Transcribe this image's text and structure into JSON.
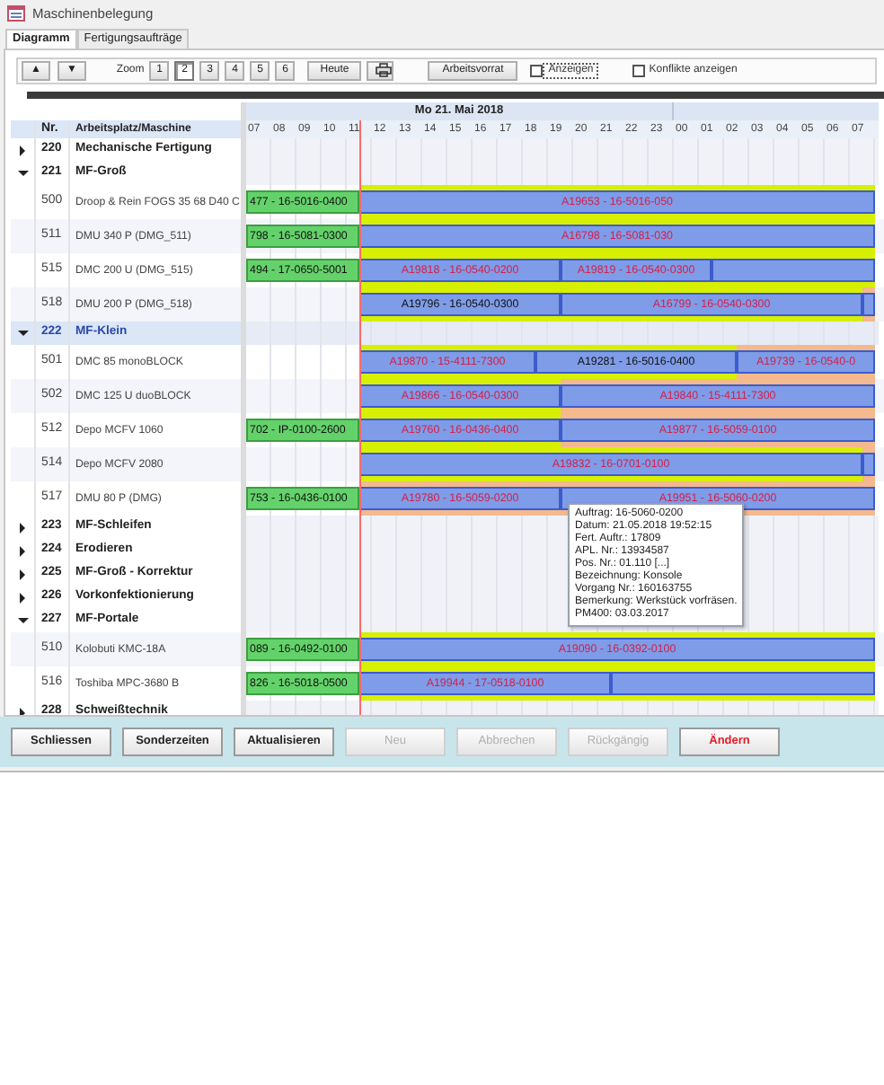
{
  "window": {
    "title": "Maschinenbelegung"
  },
  "tabs": [
    {
      "label": "Diagramm",
      "selected": true
    },
    {
      "label": "Fertigungsaufträge",
      "selected": false
    }
  ],
  "toolbar": {
    "up_button": "▲",
    "down_button": "▼",
    "zoom_label": "Zoom",
    "zoom_levels": [
      {
        "label": "1",
        "selected": false
      },
      {
        "label": "2",
        "selected": true
      },
      {
        "label": "3",
        "selected": false
      },
      {
        "label": "4",
        "selected": false
      },
      {
        "label": "5",
        "selected": false
      },
      {
        "label": "6",
        "selected": false
      }
    ],
    "today_button": "Heute",
    "backlog_button": "Arbeitsvorrat",
    "options": [
      {
        "label": "Anzeigen",
        "checked": false
      },
      {
        "label": "Konflikte anzeigen",
        "checked": false
      }
    ]
  },
  "timeline": {
    "days": [
      {
        "label": "Mo 21. Mai 2018"
      }
    ],
    "hours": [
      "07",
      "08",
      "09",
      "10",
      "11",
      "12",
      "13",
      "14",
      "15",
      "16",
      "17",
      "18",
      "19",
      "20",
      "21",
      "22",
      "23",
      "00",
      "01",
      "02",
      "03",
      "04",
      "05",
      "06",
      "07"
    ]
  },
  "columns": [
    "Nr.",
    "Arbeitsplatz/Maschine"
  ],
  "rows": [
    {
      "kind": "group",
      "nr": "220",
      "name": "Mechanische Fertigung",
      "expanded": false,
      "selected": false
    },
    {
      "kind": "group",
      "nr": "221",
      "name": "MF-Groß",
      "expanded": true,
      "selected": false
    },
    {
      "kind": "machine",
      "nr": "500",
      "name": "Droop & Rein FOGS 35 68 D40 C",
      "bars": [
        {
          "kind": "done",
          "label": "477 - 16-5016-0400",
          "overdue": false,
          "conflict": false
        },
        {
          "kind": "planned",
          "label": "A19653 - 16-5016-050",
          "overdue": true,
          "conflict": false
        }
      ]
    },
    {
      "kind": "machine",
      "nr": "511",
      "name": "DMU 340 P (DMG_511)",
      "bars": [
        {
          "kind": "done",
          "label": "798 - 16-5081-0300",
          "overdue": false,
          "conflict": false
        },
        {
          "kind": "planned",
          "label": "A16798 - 16-5081-030",
          "overdue": true,
          "conflict": false
        }
      ]
    },
    {
      "kind": "machine",
      "nr": "515",
      "name": "DMC 200 U (DMG_515)",
      "bars": [
        {
          "kind": "done",
          "label": "494 - 17-0650-5001",
          "overdue": false,
          "conflict": false
        },
        {
          "kind": "planned",
          "label": "A19818 - 16-0540-0200",
          "overdue": true,
          "conflict": false
        },
        {
          "kind": "planned",
          "label": "A19819 - 16-0540-0300",
          "overdue": true,
          "conflict": false
        },
        {
          "kind": "planned",
          "conflict": false
        }
      ]
    },
    {
      "kind": "machine",
      "nr": "518",
      "name": "DMU 200 P (DMG_518)",
      "bars": [
        {
          "kind": "planned",
          "label": "A19796 - 16-0540-0300",
          "overdue": false,
          "conflict": false
        },
        {
          "kind": "planned",
          "label": "A16799 - 16-0540-0300",
          "overdue": true,
          "conflict": false
        },
        {
          "kind": "planned",
          "conflict": true
        }
      ]
    },
    {
      "kind": "group",
      "nr": "222",
      "name": "MF-Klein",
      "expanded": true,
      "selected": true
    },
    {
      "kind": "machine",
      "nr": "501",
      "name": "DMC 85 monoBLOCK",
      "bars": [
        {
          "kind": "planned",
          "label": "A19870 - 15-4111-7300",
          "overdue": true,
          "conflict": false
        },
        {
          "kind": "planned",
          "label": "A19281 - 16-5016-0400",
          "overdue": false,
          "conflict": false
        },
        {
          "kind": "planned",
          "label": "A19739 - 16-0540-0",
          "overdue": true,
          "conflict": true
        }
      ]
    },
    {
      "kind": "machine",
      "nr": "502",
      "name": "DMC 125 U duoBLOCK",
      "bars": [
        {
          "kind": "planned",
          "label": "A19866 - 16-0540-0300",
          "overdue": true,
          "conflict": false
        },
        {
          "kind": "planned",
          "label": "A19840 - 15-4111-7300",
          "overdue": true,
          "conflict": true
        }
      ]
    },
    {
      "kind": "machine",
      "nr": "512",
      "name": "Depo MCFV 1060",
      "bars": [
        {
          "kind": "done",
          "label": "702 - IP-0100-2600",
          "overdue": false,
          "conflict": false
        },
        {
          "kind": "planned",
          "label": "A19760 - 16-0436-0400",
          "overdue": true,
          "conflict": false
        },
        {
          "kind": "planned",
          "label": "A19877 - 16-5059-0100",
          "overdue": true,
          "conflict": true
        }
      ]
    },
    {
      "kind": "machine",
      "nr": "514",
      "name": "Depo MCFV 2080",
      "bars": [
        {
          "kind": "planned",
          "label": "A19832 - 16-0701-0100",
          "overdue": true,
          "conflict": false
        },
        {
          "kind": "planned",
          "conflict": true
        }
      ]
    },
    {
      "kind": "machine",
      "nr": "517",
      "name": "DMU 80 P (DMG)",
      "bars": [
        {
          "kind": "done",
          "label": "753 - 16-0436-0100",
          "overdue": false,
          "conflict": false
        },
        {
          "kind": "planned",
          "label": "A19780 - 16-5059-0200",
          "overdue": true,
          "conflict": true
        },
        {
          "kind": "planned",
          "label": "A19951 - 16-5060-0200",
          "overdue": true,
          "conflict": true
        }
      ]
    },
    {
      "kind": "group",
      "nr": "223",
      "name": "MF-Schleifen",
      "expanded": false,
      "selected": false
    },
    {
      "kind": "group",
      "nr": "224",
      "name": "Erodieren",
      "expanded": false,
      "selected": false
    },
    {
      "kind": "group",
      "nr": "225",
      "name": "MF-Groß - Korrektur",
      "expanded": false,
      "selected": false
    },
    {
      "kind": "group",
      "nr": "226",
      "name": "Vorkonfektionierung",
      "expanded": false,
      "selected": false
    },
    {
      "kind": "group",
      "nr": "227",
      "name": "MF-Portale",
      "expanded": true,
      "selected": false
    },
    {
      "kind": "machine",
      "nr": "510",
      "name": "Kolobuti KMC-18A",
      "bars": [
        {
          "kind": "done",
          "label": "089 - 16-0492-0100",
          "overdue": false,
          "conflict": false
        },
        {
          "kind": "planned",
          "label": "A19090 - 16-0392-0100",
          "overdue": true,
          "conflict": false
        }
      ]
    },
    {
      "kind": "machine",
      "nr": "516",
      "name": "Toshiba MPC-3680 B",
      "bars": [
        {
          "kind": "done",
          "label": "826 - 16-5018-0500",
          "overdue": false,
          "conflict": false
        },
        {
          "kind": "planned",
          "label": "A19944 - 17-0518-0100",
          "overdue": true,
          "conflict": false
        },
        {
          "kind": "planned",
          "conflict": false
        }
      ]
    },
    {
      "kind": "group",
      "nr": "228",
      "name": "Schweißtechnik",
      "expanded": false,
      "selected": false
    }
  ],
  "tooltip": {
    "lines": [
      "Auftrag: 16-5060-0200",
      "Datum: 21.05.2018 19:52:15",
      "Fert. Auftr.: 17809",
      "APL. Nr.: 13934587",
      "Pos. Nr.: 01.110 [...]",
      "Bezeichnung: Konsole",
      "Vorgang Nr.: 160163755",
      "Bemerkung: Werkstück vorfräsen.",
      "PM400: 03.03.2017"
    ]
  },
  "buttons": [
    {
      "label": "Schliessen",
      "disabled": false,
      "highlighted": false
    },
    {
      "label": "Sonderzeiten",
      "disabled": false,
      "highlighted": false
    },
    {
      "label": "Aktualisieren",
      "disabled": false,
      "highlighted": false
    },
    {
      "label": "Neu",
      "disabled": true,
      "highlighted": false
    },
    {
      "label": "Abbrechen",
      "disabled": true,
      "highlighted": false
    },
    {
      "label": "Rückgängig",
      "disabled": true,
      "highlighted": false
    },
    {
      "label": "Ändern",
      "disabled": false,
      "highlighted": true
    }
  ]
}
